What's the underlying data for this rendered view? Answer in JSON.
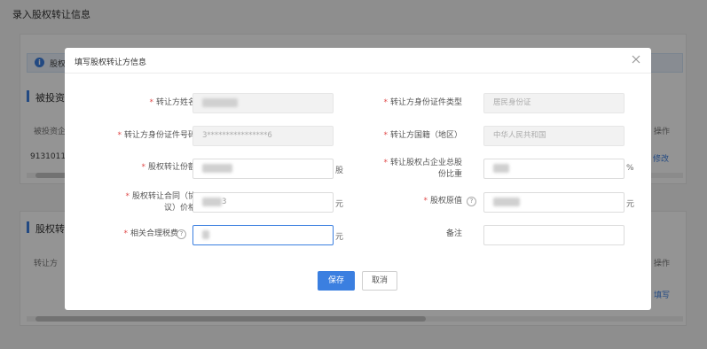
{
  "page": {
    "title": "录入股权转让信息",
    "notice": "股权",
    "section1": {
      "title": "被投资",
      "col1": "被投资企",
      "col_action": "操作",
      "row_value": "9131011",
      "row_action": "修改"
    },
    "section2": {
      "title": "股权转",
      "col1": "转让方",
      "col_action": "操作",
      "row_action": "填写"
    }
  },
  "dialog": {
    "title": "填写股权转让方信息",
    "fields": {
      "name": {
        "label": "转让方姓名",
        "value": ""
      },
      "id_type": {
        "label": "转让方身份证件类型",
        "value": "居民身份证"
      },
      "id_number": {
        "label": "转让方身份证件号码",
        "value_prefix": "3****************",
        "value_suffix": "6"
      },
      "nationality": {
        "label": "转让方国籍（地区）",
        "value": "中华人民共和国"
      },
      "amount": {
        "label": "股权转让份额",
        "unit": "股"
      },
      "ratio": {
        "label_line1": "转让股权占企业总股",
        "label_line2": "份比重",
        "unit": "%"
      },
      "price": {
        "label_line1": "股权转让合同（协",
        "label_line2": "议）价格",
        "suffix": "3",
        "unit": "元"
      },
      "original": {
        "label": "股权原值",
        "unit": "元"
      },
      "tax": {
        "label": "相关合理税费",
        "unit": "元"
      },
      "remark": {
        "label": "备注",
        "value": ""
      }
    },
    "buttons": {
      "save": "保存",
      "cancel": "取消"
    }
  },
  "colors": {
    "primary": "#3b7fe0",
    "required": "#e04a4a"
  }
}
